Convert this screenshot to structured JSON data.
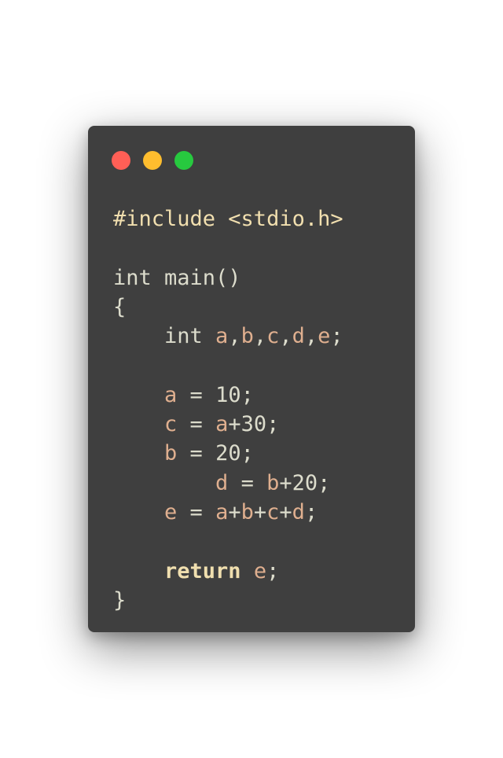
{
  "window": {
    "colors": {
      "background": "#3f3f3f",
      "close": "#ff5f56",
      "minimize": "#ffbd2e",
      "zoom": "#27c93f",
      "text": "#dcdccc",
      "variable": "#dfaf8f",
      "preprocessor": "#f1dfaf",
      "keyword": "#f0dfaf"
    }
  },
  "code": {
    "lines": [
      [
        {
          "t": "#include <stdio.h>",
          "k": "pre"
        }
      ],
      [],
      [
        {
          "t": "int main()",
          "k": "plain"
        }
      ],
      [
        {
          "t": "{",
          "k": "plain"
        }
      ],
      [
        {
          "t": "    int ",
          "k": "plain"
        },
        {
          "t": "a",
          "k": "var"
        },
        {
          "t": ",",
          "k": "plain"
        },
        {
          "t": "b",
          "k": "var"
        },
        {
          "t": ",",
          "k": "plain"
        },
        {
          "t": "c",
          "k": "var"
        },
        {
          "t": ",",
          "k": "plain"
        },
        {
          "t": "d",
          "k": "var"
        },
        {
          "t": ",",
          "k": "plain"
        },
        {
          "t": "e",
          "k": "var"
        },
        {
          "t": ";",
          "k": "plain"
        }
      ],
      [],
      [
        {
          "t": "    ",
          "k": "plain"
        },
        {
          "t": "a",
          "k": "var"
        },
        {
          "t": " = 10;",
          "k": "plain"
        }
      ],
      [
        {
          "t": "    ",
          "k": "plain"
        },
        {
          "t": "c",
          "k": "var"
        },
        {
          "t": " = ",
          "k": "plain"
        },
        {
          "t": "a",
          "k": "var"
        },
        {
          "t": "+30;",
          "k": "plain"
        }
      ],
      [
        {
          "t": "    ",
          "k": "plain"
        },
        {
          "t": "b",
          "k": "var"
        },
        {
          "t": " = 20;",
          "k": "plain"
        }
      ],
      [
        {
          "t": "        ",
          "k": "plain"
        },
        {
          "t": "d",
          "k": "var"
        },
        {
          "t": " = ",
          "k": "plain"
        },
        {
          "t": "b",
          "k": "var"
        },
        {
          "t": "+20;",
          "k": "plain"
        }
      ],
      [
        {
          "t": "    ",
          "k": "plain"
        },
        {
          "t": "e",
          "k": "var"
        },
        {
          "t": " = ",
          "k": "plain"
        },
        {
          "t": "a",
          "k": "var"
        },
        {
          "t": "+",
          "k": "plain"
        },
        {
          "t": "b",
          "k": "var"
        },
        {
          "t": "+",
          "k": "plain"
        },
        {
          "t": "c",
          "k": "var"
        },
        {
          "t": "+",
          "k": "plain"
        },
        {
          "t": "d",
          "k": "var"
        },
        {
          "t": ";",
          "k": "plain"
        }
      ],
      [],
      [
        {
          "t": "    ",
          "k": "plain"
        },
        {
          "t": "return",
          "k": "kw"
        },
        {
          "t": " ",
          "k": "plain"
        },
        {
          "t": "e",
          "k": "var"
        },
        {
          "t": ";",
          "k": "plain"
        }
      ],
      [
        {
          "t": "}",
          "k": "plain"
        }
      ]
    ]
  }
}
